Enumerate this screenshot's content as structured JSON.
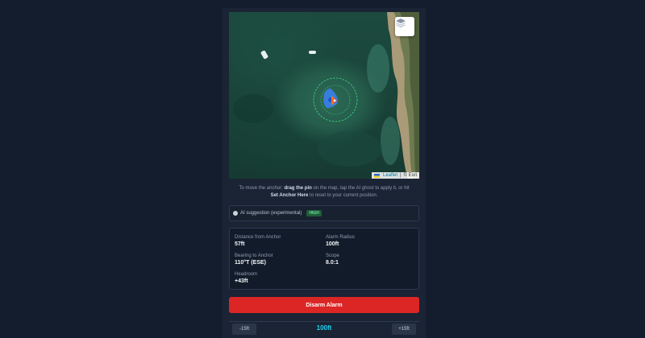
{
  "map": {
    "attribution": {
      "leaflet": "Leaflet",
      "separator": "|",
      "esri": "© Esri"
    }
  },
  "help": {
    "prefix": "To move the anchor: ",
    "drag": "drag the pin",
    "middle": " on the map, tap the AI ghost to apply it, or hit ",
    "set_anchor": "Set Anchor Here",
    "suffix": " to reset to your current position."
  },
  "ai": {
    "label": "AI suggestion (experimental)",
    "badge": "HIGH"
  },
  "stats": {
    "distance": {
      "label": "Distance from Anchor",
      "value": "57ft"
    },
    "alarm_radius": {
      "label": "Alarm Radius",
      "value": "100ft"
    },
    "bearing": {
      "label": "Bearing to Anchor",
      "value": "110°T (ESE)"
    },
    "scope": {
      "label": "Scope",
      "value": "8.0:1"
    },
    "headroom": {
      "label": "Headroom",
      "value": "+43ft"
    }
  },
  "disarm_label": "Disarm Alarm",
  "stepper": {
    "minus": "-15ft",
    "value": "100ft",
    "plus": "+15ft"
  },
  "colors": {
    "accent": "#22d3ee",
    "danger": "#dc2626",
    "radius_ring": "#3ddc84",
    "ghost": "#3b82f6",
    "badge": "#1e5c3a"
  }
}
